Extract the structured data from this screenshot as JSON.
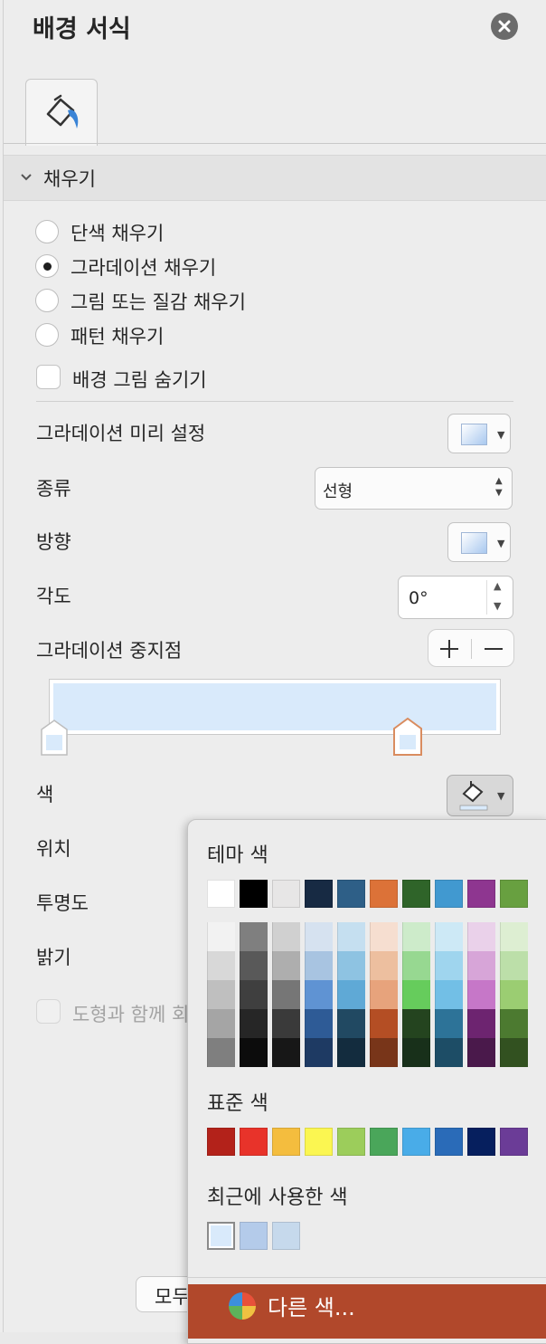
{
  "panel": {
    "title": "배경 서식",
    "section": "채우기",
    "fill_options": [
      "단색 채우기",
      "그라데이션 채우기",
      "그림 또는 질감 채우기",
      "패턴 채우기"
    ],
    "selected_fill": "그라데이션 채우기",
    "hide_bg_label": "배경 그림 숨기기",
    "preset_label": "그라데이션 미리 설정",
    "type_label": "종류",
    "type_value": "선형",
    "direction_label": "방향",
    "angle_label": "각도",
    "angle_value": "0°",
    "stops_label": "그라데이션 중지점",
    "color_label": "색",
    "position_label": "위치",
    "transparency_label": "투명도",
    "brightness_label": "밝기",
    "rotate_label_partial": "도형과 함께 회",
    "apply_all_partial": "모두"
  },
  "colors": {
    "accent": "#b1482b",
    "gradient_fill": "#d9eafb",
    "stop_selected_border": "#d98c5f"
  },
  "popup": {
    "theme_title": "테마 색",
    "theme_row": [
      "#ffffff",
      "#000000",
      "#e7e6e6",
      "#172a43",
      "#2e5f87",
      "#dc7238",
      "#2f6429",
      "#4199d0",
      "#8e3690",
      "#68a040"
    ],
    "theme_shades": [
      [
        "#f2f2f2",
        "#7f7f7f",
        "#d0d0d0",
        "#d6e2f0",
        "#c5dff0",
        "#f6ded0",
        "#cdebca",
        "#cde9f6",
        "#ead1ea",
        "#ddeed2"
      ],
      [
        "#d8d8d8",
        "#595959",
        "#aeaeae",
        "#a8c4e1",
        "#8ec3e2",
        "#edbf9f",
        "#97d891",
        "#9fd5ee",
        "#d7a5d8",
        "#bcdfa9"
      ],
      [
        "#bfbfbf",
        "#3f3f3f",
        "#767676",
        "#5f93d3",
        "#5fa9d6",
        "#e7a37c",
        "#66cc5c",
        "#72bfe6",
        "#c677c8",
        "#9bcd72"
      ],
      [
        "#a5a5a5",
        "#262626",
        "#3a3a3a",
        "#2e5b96",
        "#214962",
        "#b44e24",
        "#24441f",
        "#2d7398",
        "#6d2470",
        "#4c7a30"
      ],
      [
        "#7f7f7f",
        "#0c0c0c",
        "#171717",
        "#1e3a63",
        "#132c3e",
        "#783519",
        "#18301a",
        "#1d4d66",
        "#4a194b",
        "#325120"
      ]
    ],
    "standard_title": "표준 색",
    "standard_row": [
      "#b3221a",
      "#e8332a",
      "#f4bd3e",
      "#fbf651",
      "#9ccd5b",
      "#4aa65a",
      "#49ace8",
      "#2a6bb8",
      "#061f5e",
      "#6b3c97"
    ],
    "recent_title": "최근에 사용한 색",
    "recent_row": [
      "#d9eafb",
      "#b4cbea",
      "#c6d9ec"
    ],
    "more_colors": "다른 색..."
  }
}
